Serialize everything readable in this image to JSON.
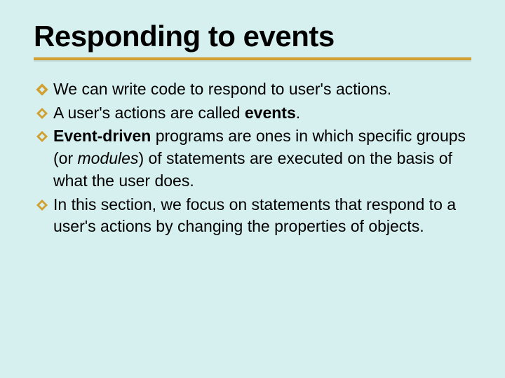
{
  "title": "Responding to events",
  "bullets": {
    "b1": "We can write code to respond to user's actions.",
    "b2_pre": "A user's actions are called ",
    "b2_bold": "events",
    "b2_post": ".",
    "b3_bold": "Event-driven",
    "b3_mid": " programs are ones in which specific groups (or ",
    "b3_italic": "modules",
    "b3_post": ") of statements are executed on the basis of what the user does.",
    "b4": "In this section, we focus on statements that respond to a user's actions by changing the properties of objects."
  }
}
